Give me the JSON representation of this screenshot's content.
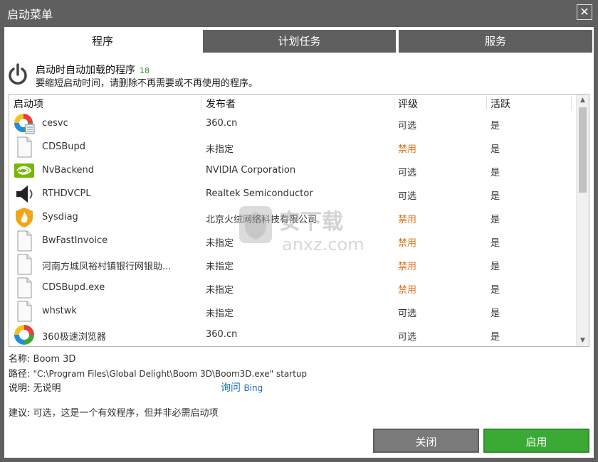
{
  "window": {
    "title": "启动菜单",
    "close_glyph": "✕"
  },
  "tabs": [
    {
      "label": "程序",
      "active": true
    },
    {
      "label": "计划任务",
      "active": false
    },
    {
      "label": "服务",
      "active": false
    }
  ],
  "header": {
    "title": "启动时自动加载的程序",
    "count": "18",
    "description": "要缩短启动时间，请删除不再需要或不再使用的程序。",
    "icon": "power-icon"
  },
  "columns": [
    "启动项",
    "发布者",
    "评级",
    "活跃"
  ],
  "rows": [
    {
      "name": "cesvc",
      "publisher": "360.cn",
      "rating": "可选",
      "rating_disabled": false,
      "active": "是",
      "icon": "360-app-icon"
    },
    {
      "name": "CDSBupd",
      "publisher": "未指定",
      "rating": "禁用",
      "rating_disabled": true,
      "active": "是",
      "icon": "file-icon"
    },
    {
      "name": "NvBackend",
      "publisher": "NVIDIA Corporation",
      "rating": "可选",
      "rating_disabled": false,
      "active": "是",
      "icon": "nvidia-icon"
    },
    {
      "name": "RTHDVCPL",
      "publisher": "Realtek Semiconductor",
      "rating": "可选",
      "rating_disabled": false,
      "active": "是",
      "icon": "speaker-icon"
    },
    {
      "name": "Sysdiag",
      "publisher": "北京火绒网络科技有限公司",
      "rating": "禁用",
      "rating_disabled": true,
      "active": "是",
      "icon": "shield-icon"
    },
    {
      "name": "BwFastInvoice",
      "publisher": "未指定",
      "rating": "禁用",
      "rating_disabled": true,
      "active": "是",
      "icon": "file-icon"
    },
    {
      "name": "河南方城凤裕村镇银行网银助...",
      "publisher": "未指定",
      "rating": "禁用",
      "rating_disabled": true,
      "active": "是",
      "icon": "file-icon"
    },
    {
      "name": "CDSBupd.exe",
      "publisher": "未指定",
      "rating": "禁用",
      "rating_disabled": true,
      "active": "是",
      "icon": "file-icon"
    },
    {
      "name": "whstwk",
      "publisher": "未指定",
      "rating": "可选",
      "rating_disabled": false,
      "active": "是",
      "icon": "file-icon"
    },
    {
      "name": "360极速浏览器",
      "publisher": "360.cn",
      "rating": "可选",
      "rating_disabled": false,
      "active": "是",
      "icon": "360-browser-icon"
    }
  ],
  "details": {
    "name_label": "名称:",
    "name_value": "Boom 3D",
    "path_label": "路径:",
    "path_value": "\"C:\\Program Files\\Global Delight\\Boom 3D\\Boom3D.exe\" startup",
    "desc_label": "说明:",
    "desc_value": "无说明",
    "ask_label": "询问",
    "ask_engine": "Bing",
    "advice_label": "建议:",
    "advice_value": "可选，这是一个有效程序，但并非必需启动项"
  },
  "watermark": {
    "text": "安下载",
    "subtext": "anxz.com"
  },
  "buttons": {
    "close_label": "关闭",
    "enable_label": "启用"
  },
  "colors": {
    "chrome": "#5f5f5f",
    "enable": "#3aaa35",
    "disabled_rating": "#d9761e",
    "link": "#1e6fb8"
  }
}
